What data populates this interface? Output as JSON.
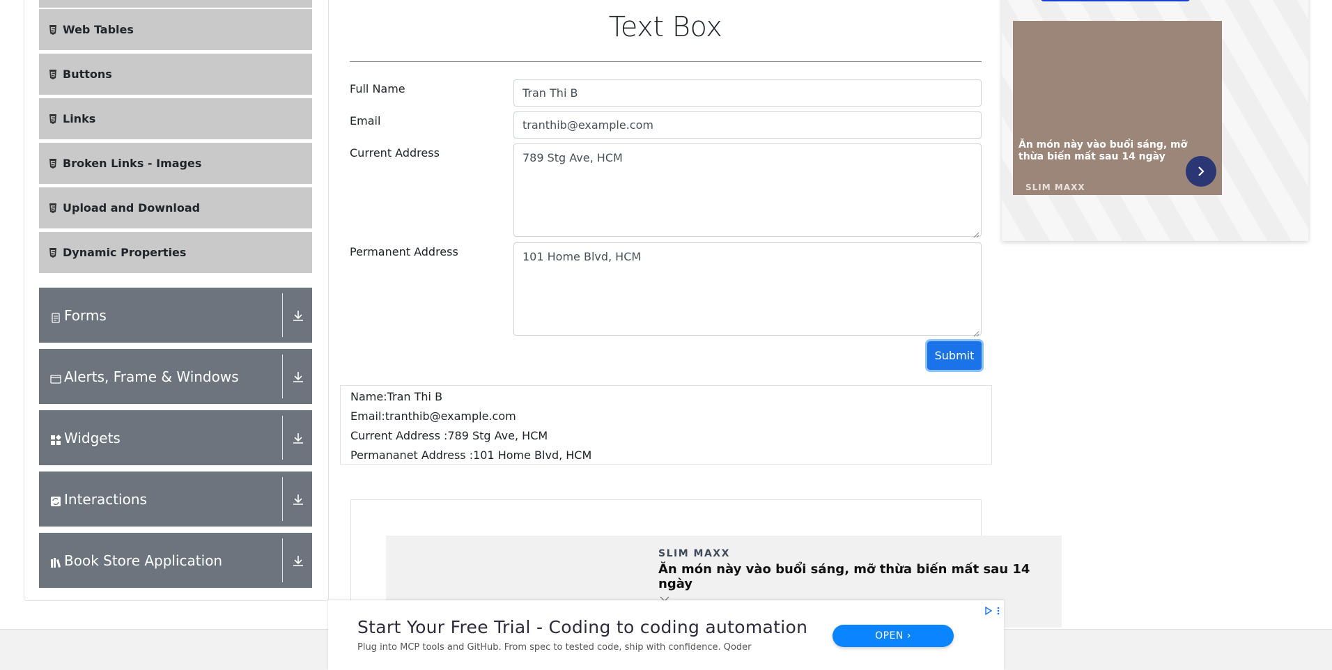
{
  "sidebar": {
    "elements_items": [
      {
        "label": "Web Tables"
      },
      {
        "label": "Buttons"
      },
      {
        "label": "Links"
      },
      {
        "label": "Broken Links - Images"
      },
      {
        "label": "Upload and Download"
      },
      {
        "label": "Dynamic Properties"
      }
    ],
    "groups": [
      {
        "label": "Forms",
        "icon": "form-icon"
      },
      {
        "label": "Alerts, Frame & Windows",
        "icon": "window-icon"
      },
      {
        "label": "Widgets",
        "icon": "widgets-icon"
      },
      {
        "label": "Interactions",
        "icon": "interactions-icon"
      },
      {
        "label": "Book Store Application",
        "icon": "books-icon"
      }
    ]
  },
  "form": {
    "title": "Text Box",
    "full_name_label": "Full Name",
    "full_name_value": "Tran Thi B",
    "email_label": "Email",
    "email_value": "tranthib@example.com",
    "current_address_label": "Current Address",
    "current_address_value": "789 Stg Ave, HCM",
    "permanent_address_label": "Permanent Address",
    "permanent_address_value": "101 Home Blvd, HCM",
    "submit_label": "Submit"
  },
  "output": {
    "name": "Name:Tran Thi B",
    "email": "Email:tranthib@example.com",
    "current_address": "Current Address :789 Stg Ave, HCM",
    "permanent_address": "Permananet Address :101 Home Blvd, HCM"
  },
  "ad_right": {
    "caption": "Ăn món này vào buổi sáng, mỡ thừa biến mất sau 14 ngày",
    "brand": "SLIM MAXX"
  },
  "ad_inline": {
    "brand": "SLIM MAXX",
    "headline": "Ăn món này vào buổi sáng, mỡ thừa biến mất sau 14 ngày"
  },
  "ad_bottom": {
    "headline": "Start Your Free Trial - Coding to coding automation",
    "subtext": "Plug into MCP tools and GitHub. From spec to tested code, ship with confidence. Qoder",
    "button_label": "OPEN"
  },
  "colors": {
    "sidebar_item_bg": "#c9c9c9",
    "group_bg": "#6c757d",
    "submit_bg": "#1a73e8",
    "open_bg": "#0a84ff"
  }
}
